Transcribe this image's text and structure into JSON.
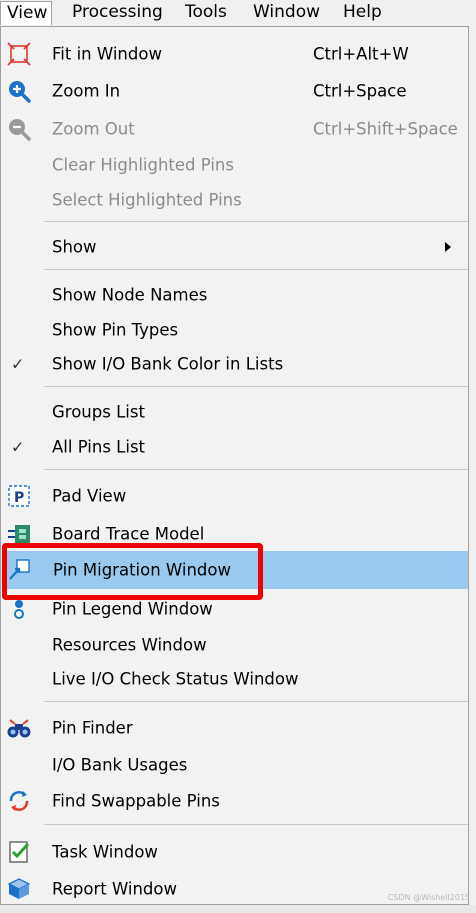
{
  "menubar": {
    "items": [
      {
        "label": "View",
        "active": true
      },
      {
        "label": "Processing"
      },
      {
        "label": "Tools"
      },
      {
        "label": "Window"
      },
      {
        "label": "Help"
      }
    ]
  },
  "menu": {
    "fit_in_window": {
      "label": "Fit in Window",
      "shortcut": "Ctrl+Alt+W"
    },
    "zoom_in": {
      "label": "Zoom In",
      "shortcut": "Ctrl+Space"
    },
    "zoom_out": {
      "label": "Zoom Out",
      "shortcut": "Ctrl+Shift+Space"
    },
    "clear_highlighted_pins": {
      "label": "Clear Highlighted Pins"
    },
    "select_highlighted_pins": {
      "label": "Select Highlighted Pins"
    },
    "show": {
      "label": "Show"
    },
    "show_node_names": {
      "label": "Show Node Names"
    },
    "show_pin_types": {
      "label": "Show Pin Types"
    },
    "show_io_bank_color": {
      "label": "Show I/O Bank Color in Lists"
    },
    "groups_list": {
      "label": "Groups List"
    },
    "all_pins_list": {
      "label": "All Pins List"
    },
    "pad_view": {
      "label": "Pad View"
    },
    "board_trace_model": {
      "label": "Board Trace Model"
    },
    "pin_migration_window": {
      "label": "Pin Migration Window"
    },
    "pin_legend_window": {
      "label": "Pin Legend Window"
    },
    "resources_window": {
      "label": "Resources Window"
    },
    "live_io_check": {
      "label": "Live I/O Check Status Window"
    },
    "pin_finder": {
      "label": "Pin Finder"
    },
    "io_bank_usages": {
      "label": "I/O Bank Usages"
    },
    "find_swappable_pins": {
      "label": "Find Swappable Pins"
    },
    "task_window": {
      "label": "Task Window"
    },
    "report_window": {
      "label": "Report Window"
    }
  },
  "colors": {
    "highlight": "#99c9ef",
    "annotation_box": "#ee0000",
    "disabled_text": "#8c8c8c"
  },
  "watermark": "CSDN @Wishell2015"
}
